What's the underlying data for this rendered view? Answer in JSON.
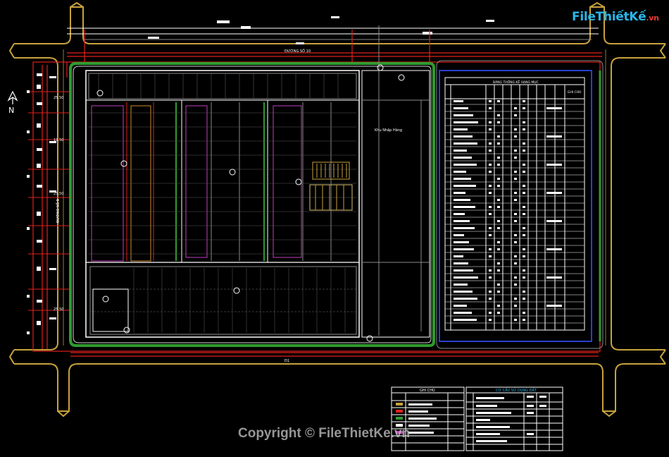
{
  "brand": {
    "name": "FileThiếtKế",
    "suffix": ".vn"
  },
  "copyright": "Copyright © FileThietKe.vn",
  "labels": {
    "road_top": "ĐƯỜNG SỐ 10",
    "road_bottom": "Đ1",
    "north": "N",
    "loading_area": "Khu Nhập Hàng",
    "stats_table_title": "BẢNG THỐNG KÊ HẠNG MỤC",
    "stats_table_note_col": "GHI CHÚ",
    "legend_title": "GHI CHÚ",
    "land_use_title": "CƠ CẤU SỬ DỤNG ĐẤT",
    "road_left": "ĐƯỜNG SỐ 9",
    "dims_left": [
      "25.50",
      "19.50",
      "25.50",
      "25.50"
    ]
  },
  "colors": {
    "background": "#000000",
    "road_outline": "#c8a23c",
    "property_line": "#e0201a",
    "white_line": "#ffffff",
    "grey_line": "#8a8a8a",
    "green_hedge": "#2f9a2f",
    "blue_border": "#2a3fd0",
    "magenta": "#c040c0",
    "cyan": "#29b6e8"
  }
}
